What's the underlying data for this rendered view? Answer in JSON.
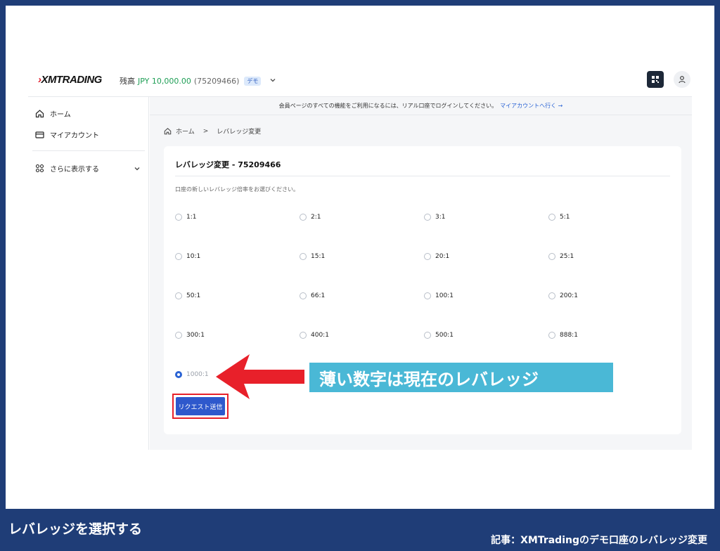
{
  "header": {
    "logo": "XMTRADING",
    "balance_label": "残高",
    "balance_amount": "JPY 10,000.00",
    "account_number": "(75209466)",
    "demo_badge": "デモ"
  },
  "sidebar": {
    "items": [
      {
        "label": "ホーム",
        "icon": "home-icon"
      },
      {
        "label": "マイアカウント",
        "icon": "card-icon"
      },
      {
        "label": "さらに表示する",
        "icon": "grid-icon"
      }
    ]
  },
  "notice": {
    "text": "会員ページのすべての機能をご利用になるには、リアル口座でログインしてください。",
    "link": "マイアカウントへ行く →"
  },
  "breadcrumb": {
    "home": "ホーム",
    "separator": ">",
    "current": "レバレッジ変更"
  },
  "card": {
    "title": "レバレッジ変更 - 75209466",
    "description": "口座の新しいレバレッジ倍率をお選びください。",
    "options": [
      "1:1",
      "2:1",
      "3:1",
      "5:1",
      "10:1",
      "15:1",
      "20:1",
      "25:1",
      "50:1",
      "66:1",
      "100:1",
      "200:1",
      "300:1",
      "400:1",
      "500:1",
      "888:1",
      "1000:1"
    ],
    "selected": "1000:1",
    "submit_label": "リクエスト送信"
  },
  "annotation": {
    "callout": "薄い数字は現在のレバレッジ"
  },
  "footer": {
    "title": "レバレッジを選択する",
    "source": "記事：XMTradingのデモ口座のレバレッジ変更"
  },
  "colors": {
    "frame": "#1f3d77",
    "accent": "#2e58cc",
    "highlight_red": "#e8202a",
    "callout_bg": "#4ab8d6",
    "balance_green": "#1e9e55"
  }
}
